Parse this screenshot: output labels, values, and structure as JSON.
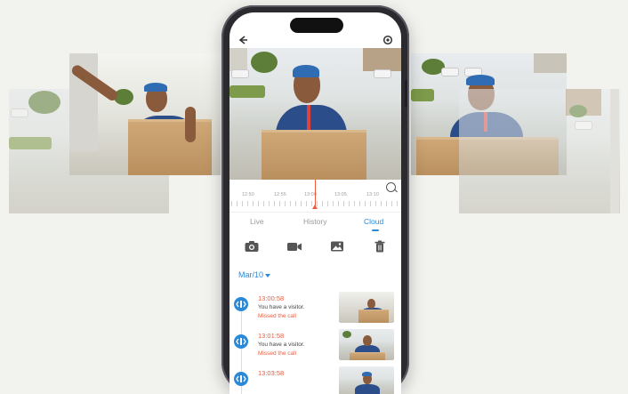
{
  "tabs": [
    {
      "label": "Live"
    },
    {
      "label": "History"
    },
    {
      "label": "Cloud"
    }
  ],
  "active_tab": "Cloud",
  "timeline": {
    "labels": [
      "12:50",
      "12:55",
      "13:00",
      "13:05",
      "13:10"
    ]
  },
  "actions": [
    "camera-icon",
    "video-icon",
    "image-icon",
    "trash-icon"
  ],
  "date": "Mar/10",
  "events": [
    {
      "time": "13:00:58",
      "message": "You have a visitor.",
      "status": "Missed the call"
    },
    {
      "time": "13:01:58",
      "message": "You have a visitor.",
      "status": "Missed the call"
    },
    {
      "time": "13:03:58",
      "message": "",
      "status": ""
    }
  ],
  "colors": {
    "accent": "#2a8ad8",
    "alert": "#f05a3a",
    "phone_frame": "#2b2a2e",
    "background": "#f2f2ee"
  }
}
